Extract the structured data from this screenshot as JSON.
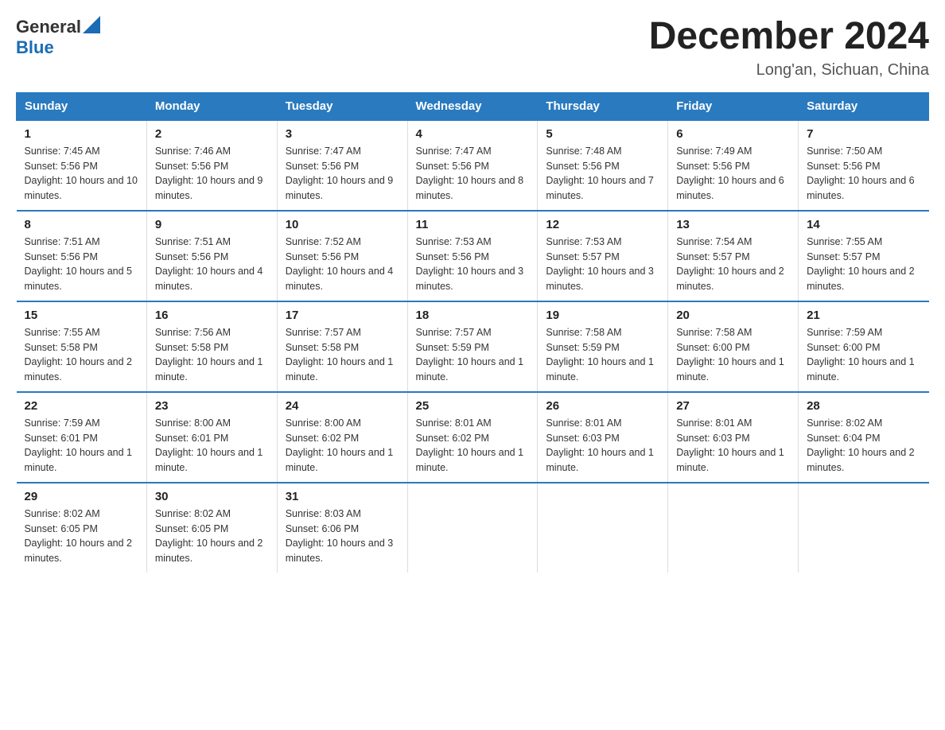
{
  "header": {
    "logo_general": "General",
    "logo_blue": "Blue",
    "month_title": "December 2024",
    "location": "Long'an, Sichuan, China"
  },
  "days_of_week": [
    "Sunday",
    "Monday",
    "Tuesday",
    "Wednesday",
    "Thursday",
    "Friday",
    "Saturday"
  ],
  "weeks": [
    [
      {
        "day": "1",
        "sunrise": "7:45 AM",
        "sunset": "5:56 PM",
        "daylight": "10 hours and 10 minutes."
      },
      {
        "day": "2",
        "sunrise": "7:46 AM",
        "sunset": "5:56 PM",
        "daylight": "10 hours and 9 minutes."
      },
      {
        "day": "3",
        "sunrise": "7:47 AM",
        "sunset": "5:56 PM",
        "daylight": "10 hours and 9 minutes."
      },
      {
        "day": "4",
        "sunrise": "7:47 AM",
        "sunset": "5:56 PM",
        "daylight": "10 hours and 8 minutes."
      },
      {
        "day": "5",
        "sunrise": "7:48 AM",
        "sunset": "5:56 PM",
        "daylight": "10 hours and 7 minutes."
      },
      {
        "day": "6",
        "sunrise": "7:49 AM",
        "sunset": "5:56 PM",
        "daylight": "10 hours and 6 minutes."
      },
      {
        "day": "7",
        "sunrise": "7:50 AM",
        "sunset": "5:56 PM",
        "daylight": "10 hours and 6 minutes."
      }
    ],
    [
      {
        "day": "8",
        "sunrise": "7:51 AM",
        "sunset": "5:56 PM",
        "daylight": "10 hours and 5 minutes."
      },
      {
        "day": "9",
        "sunrise": "7:51 AM",
        "sunset": "5:56 PM",
        "daylight": "10 hours and 4 minutes."
      },
      {
        "day": "10",
        "sunrise": "7:52 AM",
        "sunset": "5:56 PM",
        "daylight": "10 hours and 4 minutes."
      },
      {
        "day": "11",
        "sunrise": "7:53 AM",
        "sunset": "5:56 PM",
        "daylight": "10 hours and 3 minutes."
      },
      {
        "day": "12",
        "sunrise": "7:53 AM",
        "sunset": "5:57 PM",
        "daylight": "10 hours and 3 minutes."
      },
      {
        "day": "13",
        "sunrise": "7:54 AM",
        "sunset": "5:57 PM",
        "daylight": "10 hours and 2 minutes."
      },
      {
        "day": "14",
        "sunrise": "7:55 AM",
        "sunset": "5:57 PM",
        "daylight": "10 hours and 2 minutes."
      }
    ],
    [
      {
        "day": "15",
        "sunrise": "7:55 AM",
        "sunset": "5:58 PM",
        "daylight": "10 hours and 2 minutes."
      },
      {
        "day": "16",
        "sunrise": "7:56 AM",
        "sunset": "5:58 PM",
        "daylight": "10 hours and 1 minute."
      },
      {
        "day": "17",
        "sunrise": "7:57 AM",
        "sunset": "5:58 PM",
        "daylight": "10 hours and 1 minute."
      },
      {
        "day": "18",
        "sunrise": "7:57 AM",
        "sunset": "5:59 PM",
        "daylight": "10 hours and 1 minute."
      },
      {
        "day": "19",
        "sunrise": "7:58 AM",
        "sunset": "5:59 PM",
        "daylight": "10 hours and 1 minute."
      },
      {
        "day": "20",
        "sunrise": "7:58 AM",
        "sunset": "6:00 PM",
        "daylight": "10 hours and 1 minute."
      },
      {
        "day": "21",
        "sunrise": "7:59 AM",
        "sunset": "6:00 PM",
        "daylight": "10 hours and 1 minute."
      }
    ],
    [
      {
        "day": "22",
        "sunrise": "7:59 AM",
        "sunset": "6:01 PM",
        "daylight": "10 hours and 1 minute."
      },
      {
        "day": "23",
        "sunrise": "8:00 AM",
        "sunset": "6:01 PM",
        "daylight": "10 hours and 1 minute."
      },
      {
        "day": "24",
        "sunrise": "8:00 AM",
        "sunset": "6:02 PM",
        "daylight": "10 hours and 1 minute."
      },
      {
        "day": "25",
        "sunrise": "8:01 AM",
        "sunset": "6:02 PM",
        "daylight": "10 hours and 1 minute."
      },
      {
        "day": "26",
        "sunrise": "8:01 AM",
        "sunset": "6:03 PM",
        "daylight": "10 hours and 1 minute."
      },
      {
        "day": "27",
        "sunrise": "8:01 AM",
        "sunset": "6:03 PM",
        "daylight": "10 hours and 1 minute."
      },
      {
        "day": "28",
        "sunrise": "8:02 AM",
        "sunset": "6:04 PM",
        "daylight": "10 hours and 2 minutes."
      }
    ],
    [
      {
        "day": "29",
        "sunrise": "8:02 AM",
        "sunset": "6:05 PM",
        "daylight": "10 hours and 2 minutes."
      },
      {
        "day": "30",
        "sunrise": "8:02 AM",
        "sunset": "6:05 PM",
        "daylight": "10 hours and 2 minutes."
      },
      {
        "day": "31",
        "sunrise": "8:03 AM",
        "sunset": "6:06 PM",
        "daylight": "10 hours and 3 minutes."
      },
      null,
      null,
      null,
      null
    ]
  ]
}
